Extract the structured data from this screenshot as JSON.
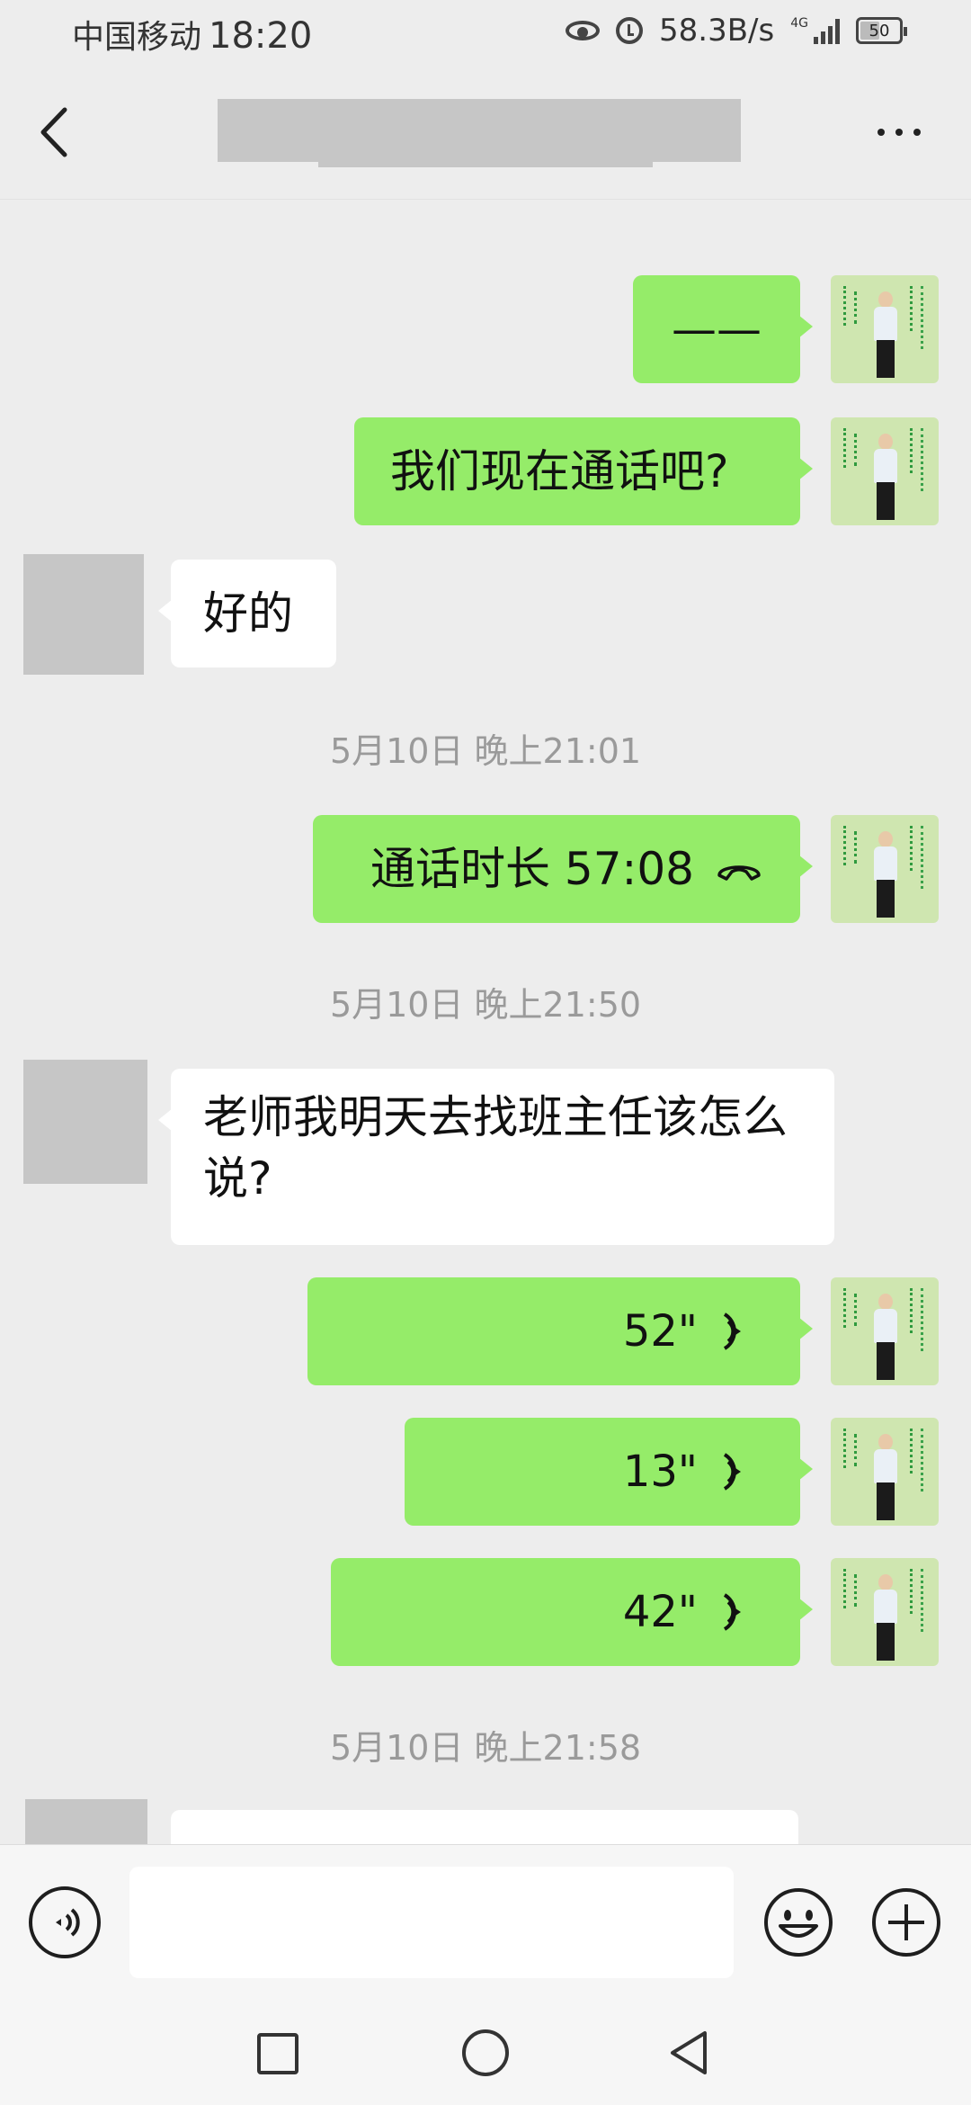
{
  "status_bar": {
    "carrier": "中国移动",
    "time": "18:20",
    "network_speed": "58.3B/s",
    "network_type": "4G",
    "battery": "50"
  },
  "header": {
    "back_icon": "chevron-left-icon",
    "more_icon": "more-horizontal-icon"
  },
  "messages": [
    {
      "side": "out",
      "text": "——"
    },
    {
      "side": "out",
      "text": "我们现在通话吧?"
    },
    {
      "side": "in",
      "text": "好的"
    },
    {
      "timestamp": "5月10日 晚上21:01"
    },
    {
      "side": "out",
      "type": "call",
      "text": "通话时长 57:08",
      "icon": "phone-hangup-icon"
    },
    {
      "timestamp": "5月10日 晚上21:50"
    },
    {
      "side": "in",
      "text": "老师我明天去找班主任该怎么说?"
    },
    {
      "side": "out",
      "type": "voice",
      "duration": "52\"",
      "icon": "voice-wave-icon"
    },
    {
      "side": "out",
      "type": "voice",
      "duration": "13\"",
      "icon": "voice-wave-icon"
    },
    {
      "side": "out",
      "type": "voice",
      "duration": "42\"",
      "icon": "voice-wave-icon"
    },
    {
      "timestamp": "5月10日 晚上21:58"
    }
  ],
  "input_bar": {
    "voice_icon": "voice-toggle-icon",
    "input_value": "",
    "emoji_icon": "emoji-icon",
    "plus_icon": "plus-icon"
  },
  "nav_bar": {
    "recent_icon": "square-icon",
    "home_icon": "circle-icon",
    "back_icon": "triangle-back-icon"
  },
  "colors": {
    "outgoing_bubble": "#95ec69",
    "incoming_bubble": "#ffffff",
    "chat_background": "#ededed"
  }
}
